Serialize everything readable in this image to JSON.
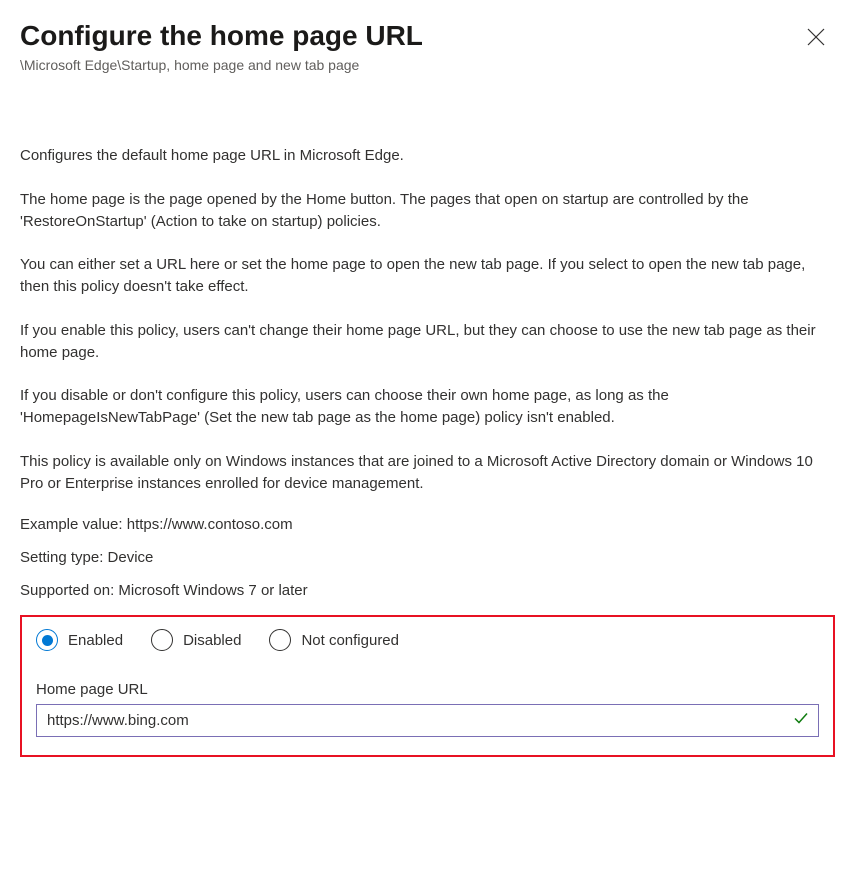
{
  "header": {
    "title": "Configure the home page URL",
    "breadcrumb": "\\Microsoft Edge\\Startup, home page and new tab page"
  },
  "description": {
    "p1": "Configures the default home page URL in Microsoft Edge.",
    "p2": "The home page is the page opened by the Home button. The pages that open on startup are controlled by the 'RestoreOnStartup' (Action to take on startup) policies.",
    "p3": "You can either set a URL here or set the home page to open the new tab page. If you select to open the new tab page, then this policy doesn't take effect.",
    "p4": "If you enable this policy, users can't change their home page URL, but they can choose to use the new tab page as their home page.",
    "p5": "If you disable or don't configure this policy, users can choose their own home page, as long as the 'HomepageIsNewTabPage' (Set the new tab page as the home page) policy isn't enabled.",
    "p6": "This policy is available only on Windows instances that are joined to a Microsoft Active Directory domain or Windows 10 Pro or Enterprise instances enrolled for device management."
  },
  "meta": {
    "example": "Example value: https://www.contoso.com",
    "setting_type": "Setting type: Device",
    "supported_on": "Supported on: Microsoft Windows 7 or later"
  },
  "config": {
    "options": {
      "enabled": "Enabled",
      "disabled": "Disabled",
      "not_configured": "Not configured"
    },
    "field_label": "Home page URL",
    "field_value": "https://www.bing.com"
  }
}
